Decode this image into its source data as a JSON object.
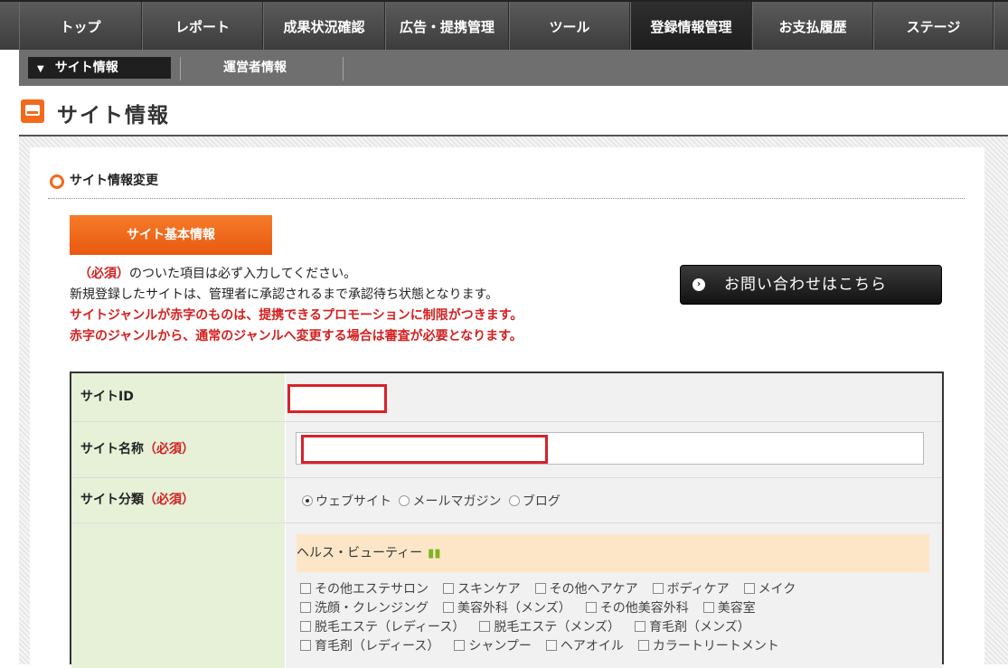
{
  "topnav": {
    "items": [
      "トップ",
      "レポート",
      "成果状況確認",
      "広告・提携管理",
      "ツール",
      "登録情報管理",
      "お支払履歴",
      "ステージ"
    ],
    "active_index": 5
  },
  "subnav": {
    "active": "サイト情報",
    "items": [
      "運営者情報"
    ]
  },
  "page": {
    "title": "サイト情報"
  },
  "section": {
    "heading": "サイト情報変更",
    "tab_label": "サイト基本情報"
  },
  "notes": {
    "required_mark": "（必須）",
    "line1_rest": "のついた項目は必ず入力してください。",
    "line2": "新規登録したサイトは、管理者に承認されるまで承認待ち状態となります。",
    "line3": "サイトジャンルが赤字のものは、提携できるプロモーションに制限がつきます。",
    "line4": "赤字のジャンルから、通常のジャンルへ変更する場合は審査が必要となります。"
  },
  "contact_button": {
    "label": "お問い合わせはこちら"
  },
  "form": {
    "site_id_label": "サイトID",
    "site_name_label": "サイト名称",
    "site_name_req": "（必須）",
    "site_type_label": "サイト分類",
    "site_type_req": "（必須）",
    "site_type_options": [
      "ウェブサイト",
      "メールマガジン",
      "ブログ"
    ],
    "site_type_selected": "ウェブサイト",
    "genre_head": "ヘルス・ビューティー",
    "genres": [
      "その他エステサロン",
      "スキンケア",
      "その他ヘアケア",
      "ボディケア",
      "メイク",
      "洗顔・クレンジング",
      "美容外科（メンズ）",
      "その他美容外科",
      "美容室",
      "脱毛エステ（レディース）",
      "脱毛エステ（メンズ）",
      "育毛剤（メンズ）",
      "育毛剤（レディース）",
      "シャンプー",
      "ヘアオイル",
      "カラートリートメント"
    ]
  },
  "colors": {
    "accent_orange": "#f26a1b",
    "required_red": "#d42020",
    "highlight_box": "#d6232b",
    "label_bg": "#e6f1d8",
    "genre_head_bg": "#fde6c8"
  }
}
